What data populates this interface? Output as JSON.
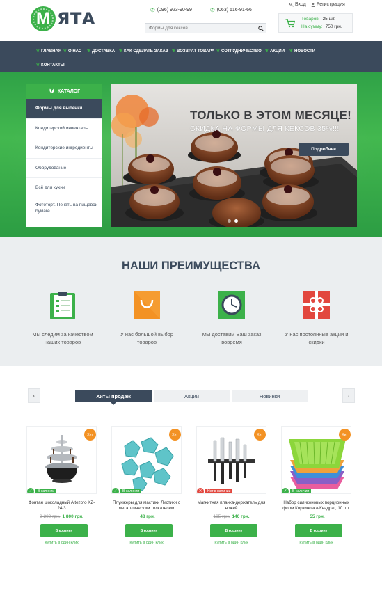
{
  "header": {
    "logo_letter": "М",
    "logo_text": "ЯТА",
    "phone1": "(096) 923-90-99",
    "phone2": "(063) 616-91-66",
    "login": "Вход",
    "register": "Регистрация",
    "search_placeholder": "Формы для кексов",
    "cart": {
      "items_label": "Товаров:",
      "items_value": "25 шт.",
      "sum_label": "На сумму:",
      "sum_value": "750 грн."
    }
  },
  "nav": {
    "items": [
      "Главная",
      "О нас",
      "Доставка",
      "Как сделать заказ",
      "Возврат товара",
      "Сотрудничество",
      "Акции",
      "Новости",
      "Контакты"
    ]
  },
  "catalog": {
    "title": "Каталог",
    "items": [
      "Формы для выпечки",
      "Кондитерский инвентарь",
      "Кондитерские ингредиенты",
      "Оборудование",
      "Всё для кухни",
      "Фототорт. Печать на пищевой бумаге"
    ]
  },
  "slider": {
    "title": "ТОЛЬКО В ЭТОМ МЕСЯЦЕ!",
    "subtitle": "СКИДКА НА ФОРМЫ ДЛЯ КЕКСОВ 35%!!!",
    "button": "Подробнее",
    "slides_count": 2,
    "active_slide": 2
  },
  "advantages": {
    "title": "НАШИ ПРЕИМУЩЕСТВА",
    "items": [
      {
        "line1": "Мы следим за качеством",
        "line2": "наших товаров",
        "icon": "clipboard-icon"
      },
      {
        "line1": "У нас большой выбор",
        "line2": "товаров",
        "icon": "shopping-bag-icon"
      },
      {
        "line1": "Мы доставим Ваш заказ",
        "line2": "вовремя",
        "icon": "clock-icon"
      },
      {
        "line1": "У нас постоянные акции и",
        "line2": "скидки",
        "icon": "gift-icon"
      }
    ]
  },
  "products": {
    "prev": "‹",
    "next": "›",
    "tabs": [
      "Хиты продаж",
      "Акции",
      "Новинки"
    ],
    "badge": "Хит",
    "buy_label": "В корзину",
    "one_click": "Купить в один клик",
    "items": [
      {
        "name": "Фонтан шоколадный Altezoro KZ-24/3",
        "old_price": "2 200 грн.",
        "price": "1 800 грн.",
        "stock": "В наличии",
        "in_stock": true
      },
      {
        "name": "Плунжеры для мастики Листики с металлическим толкателем",
        "old_price": "",
        "price": "48 грн.",
        "stock": "В наличии",
        "in_stock": true
      },
      {
        "name": "Магнитная планка-держатель для ножей",
        "old_price": "165 грн.",
        "price": "140 грн.",
        "stock": "Нет в наличии",
        "in_stock": false
      },
      {
        "name": "Набор силиконовых порционных форм Корзиночка-Квадрат, 10 шт.",
        "old_price": "",
        "price": "55 грн.",
        "stock": "В наличии",
        "in_stock": true
      }
    ]
  },
  "colors": {
    "brand_green": "#3cb14a",
    "dark_navy": "#3b4a5c",
    "badge_orange": "#f39224",
    "out_of_stock_red": "#e2473e"
  }
}
